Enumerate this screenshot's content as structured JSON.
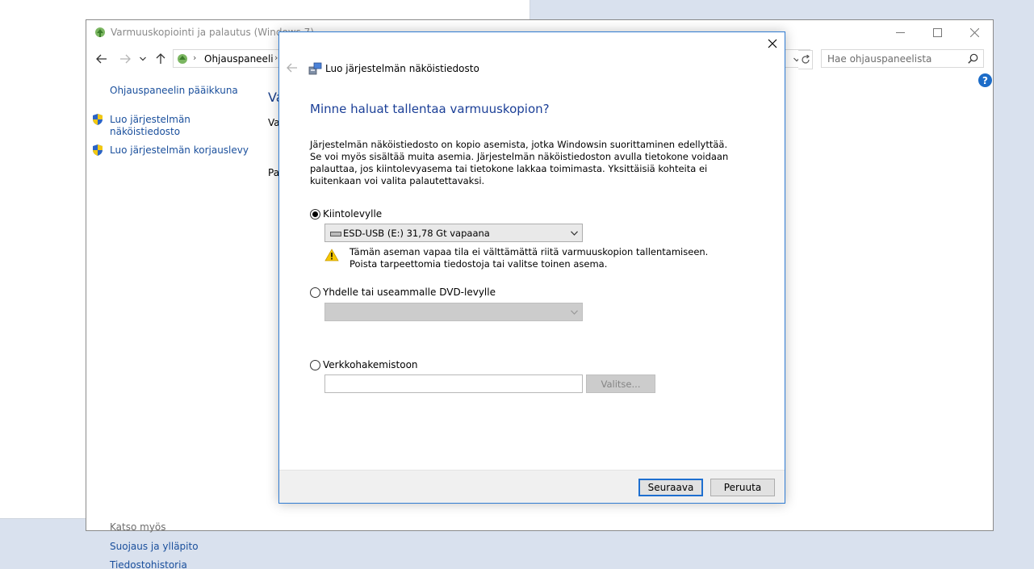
{
  "colors": {
    "desktop_bg": "#d9e1ee",
    "link_blue": "#1a4f9c",
    "heading_blue": "#1b3f97",
    "dialog_border": "#2f7bd2",
    "primary_button_border": "#1e6fd0"
  },
  "control_panel": {
    "title": "Varmuuskopiointi ja palautus (Windows 7)",
    "address": {
      "crumb": "Ohjauspaneeli",
      "separator": "›"
    },
    "search": {
      "placeholder": "Hae ohjauspaneelista"
    },
    "sidebar": {
      "home_link": "Ohjauspaneelin pääikkuna",
      "items": [
        {
          "label": "Luo järjestelmän näköistiedosto",
          "icon": "uac-shield-icon"
        },
        {
          "label": "Luo järjestelmän korjauslevy",
          "icon": "uac-shield-icon"
        }
      ],
      "see_also_title": "Katso myös",
      "see_also": [
        "Suojaus ja ylläpito",
        "Tiedostohistoria"
      ]
    },
    "main_fragments": [
      "Va",
      "Va",
      "Pa"
    ]
  },
  "dialog": {
    "wizard_title": "Luo järjestelmän näköistiedosto",
    "heading": "Minne haluat tallentaa varmuuskopion?",
    "description": "Järjestelmän näköistiedosto on kopio asemista, jotka Windowsin suorittaminen edellyttää. Se voi myös sisältää muita asemia. Järjestelmän näköistiedoston avulla tietokone voidaan palauttaa, jos kiintolevyasema tai tietokone lakkaa toimimasta. Yksittäisiä kohteita ei kuitenkaan voi valita palautettavaksi.",
    "options": {
      "hard_disk": {
        "label": "Kiintolevylle",
        "selected": true,
        "drive_value": "ESD-USB (E:) 31,78 Gt vapaana",
        "warning": "Tämän aseman vapaa tila ei välttämättä riitä varmuuskopion tallentamiseen. Poista tarpeettomia tiedostoja tai valitse toinen asema."
      },
      "dvd": {
        "label": "Yhdelle tai useammalle DVD-levylle",
        "selected": false
      },
      "network": {
        "label": "Verkkohakemistoon",
        "selected": false,
        "path_value": "",
        "browse_label": "Valitse..."
      }
    },
    "buttons": {
      "next": "Seuraava",
      "cancel": "Peruuta"
    }
  }
}
